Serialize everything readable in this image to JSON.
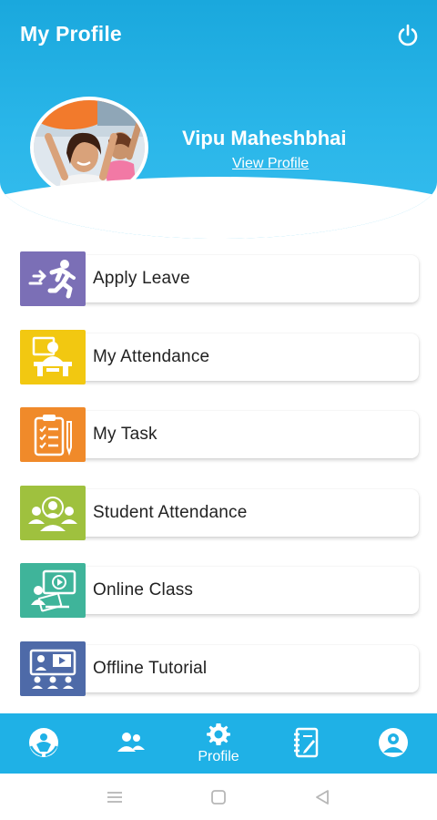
{
  "header": {
    "title": "My Profile",
    "power_icon": "power-icon"
  },
  "profile": {
    "name": "Vipu Maheshbhai",
    "view_profile_label": "View Profile",
    "avatar": "avatar-photo"
  },
  "menu": {
    "items": [
      {
        "label": "Apply Leave",
        "icon": "running-exit-icon",
        "color": "#7b6fb6"
      },
      {
        "label": "My Attendance",
        "icon": "person-at-desk-icon",
        "color": "#f2c811"
      },
      {
        "label": "My Task",
        "icon": "clipboard-checklist-icon",
        "color": "#f08a2a"
      },
      {
        "label": "Student Attendance",
        "icon": "group-people-icon",
        "color": "#9fc13e"
      },
      {
        "label": "Online Class",
        "icon": "video-lesson-icon",
        "color": "#3fb49a"
      },
      {
        "label": "Offline Tutorial",
        "icon": "classroom-presentation-icon",
        "color": "#4e6aa8"
      }
    ]
  },
  "bottom_nav": {
    "items": [
      {
        "label": "",
        "icon": "care-hands-icon"
      },
      {
        "label": "",
        "icon": "people-icon"
      },
      {
        "label": "Profile",
        "icon": "gear-icon"
      },
      {
        "label": "",
        "icon": "notebook-icon"
      },
      {
        "label": "",
        "icon": "account-circle-icon"
      }
    ],
    "active": "Profile"
  },
  "system_nav": {
    "items": [
      "menu-icon",
      "home-square-icon",
      "back-triangle-icon"
    ]
  },
  "colors": {
    "header_blue": "#1aa8dd",
    "nav_blue": "#1fb1e6",
    "text_dark": "#222222"
  }
}
